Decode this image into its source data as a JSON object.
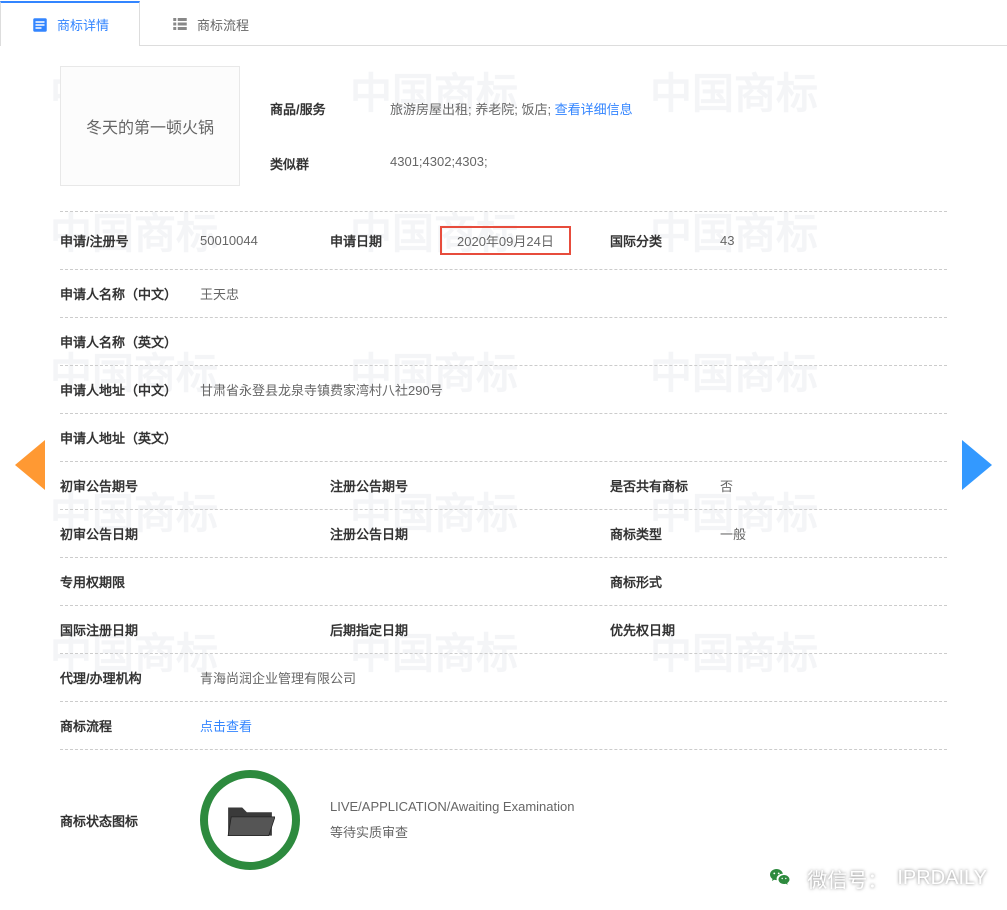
{
  "tabs": {
    "detail": "商标详情",
    "process": "商标流程"
  },
  "trademark_name": "冬天的第一顿火锅",
  "top": {
    "goods_label": "商品/服务",
    "goods_value": "旅游房屋出租; 养老院; 饭店; ",
    "goods_link": "查看详细信息",
    "group_label": "类似群",
    "group_value": "4301;4302;4303;"
  },
  "rows": {
    "reg_no_label": "申请/注册号",
    "reg_no": "50010044",
    "app_date_label": "申请日期",
    "app_date": "2020年09月24日",
    "intl_class_label": "国际分类",
    "intl_class": "43",
    "applicant_cn_label": "申请人名称（中文）",
    "applicant_cn": "王天忠",
    "applicant_en_label": "申请人名称（英文）",
    "applicant_en": "",
    "addr_cn_label": "申请人地址（中文）",
    "addr_cn": "甘肃省永登县龙泉寺镇费家湾村八社290号",
    "addr_en_label": "申请人地址（英文）",
    "addr_en": "",
    "prelim_no_label": "初审公告期号",
    "prelim_no": "",
    "reg_ann_no_label": "注册公告期号",
    "reg_ann_no": "",
    "joint_label": "是否共有商标",
    "joint": "否",
    "prelim_date_label": "初审公告日期",
    "prelim_date": "",
    "reg_ann_date_label": "注册公告日期",
    "reg_ann_date": "",
    "tm_type_label": "商标类型",
    "tm_type": "一般",
    "excl_period_label": "专用权期限",
    "excl_period": "",
    "tm_form_label": "商标形式",
    "tm_form": "",
    "intl_reg_date_label": "国际注册日期",
    "intl_reg_date": "",
    "later_date_label": "后期指定日期",
    "later_date": "",
    "priority_date_label": "优先权日期",
    "priority_date": "",
    "agent_label": "代理/办理机构",
    "agent": "青海尚润企业管理有限公司",
    "process_label": "商标流程",
    "process_link": "点击查看",
    "status_label": "商标状态图标",
    "status_en": "LIVE/APPLICATION/Awaiting Examination",
    "status_cn": "等待实质审查"
  },
  "footer": {
    "wx_label": "微信号：",
    "wx_id": "IPRDAILY"
  },
  "watermark": "中国商标"
}
